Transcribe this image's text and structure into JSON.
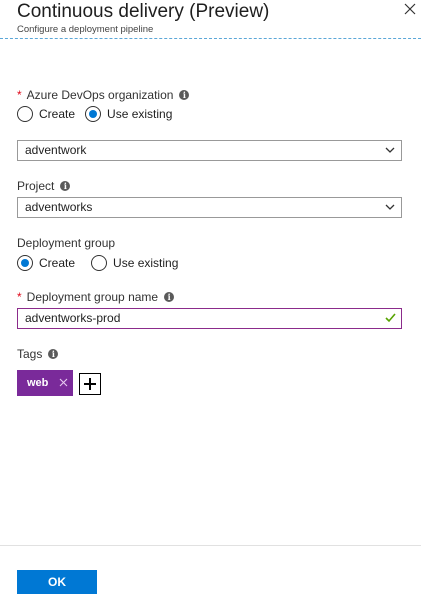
{
  "header": {
    "title": "Continuous delivery (Preview)",
    "subtitle": "Configure a deployment pipeline"
  },
  "form": {
    "organization": {
      "label": "Azure DevOps organization",
      "required_mark": "*",
      "options": [
        "Create",
        "Use existing"
      ],
      "selected": "Use existing",
      "value": "adventwork"
    },
    "project": {
      "label": "Project",
      "value": "adventworks"
    },
    "deployment_group": {
      "label": "Deployment group",
      "options": [
        "Create",
        "Use existing"
      ],
      "selected": "Create"
    },
    "deployment_group_name": {
      "label": "Deployment group name",
      "required_mark": "*",
      "value": "adventworks-prod"
    },
    "tags": {
      "label": "Tags",
      "items": [
        "web"
      ]
    }
  },
  "footer": {
    "ok_label": "OK"
  },
  "colors": {
    "accent": "#0078d4",
    "tag": "#7a2a9a",
    "required": "#e00b1c",
    "valid_check": "#57a300"
  },
  "icons": [
    "close-icon",
    "info-icon",
    "chevron-down-icon",
    "checkmark-icon",
    "tag-remove-icon",
    "plus-icon"
  ]
}
